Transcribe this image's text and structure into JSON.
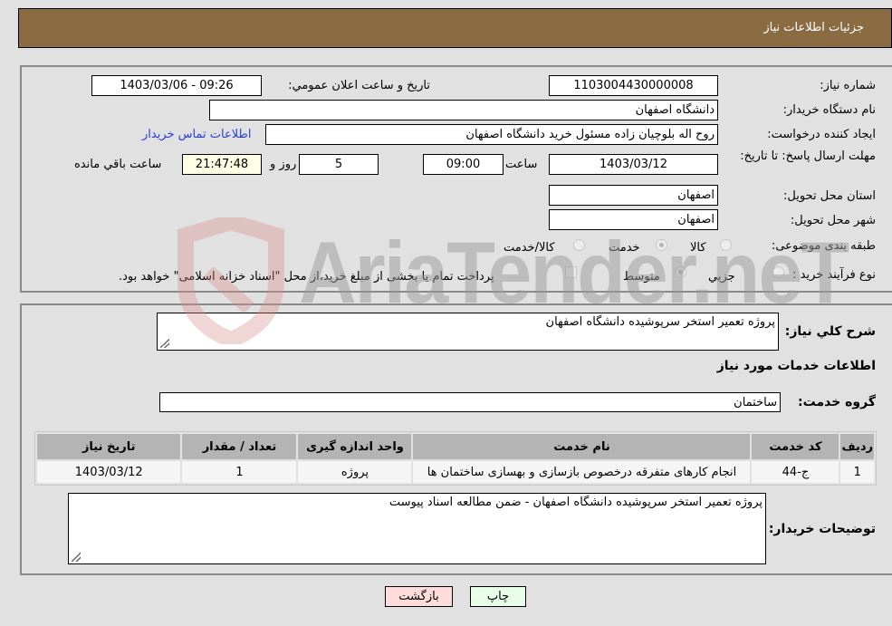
{
  "header": {
    "title": "جزئيات اطلاعات نياز"
  },
  "form": {
    "need_number_label": "شماره نياز:",
    "need_number": "1103004430000008",
    "announce_label": "تاريخ و ساعت اعلان عمومي:",
    "announce_value": "1403/03/06 - 09:26",
    "buyer_org_label": "نام دستگاه خريدار:",
    "buyer_org": "دانشگاه اصفهان",
    "creator_label": "ايجاد کننده درخواست:",
    "creator": "روح اله بلوچيان زاده مسئول خريد دانشگاه اصفهان",
    "contact_link": "اطلاعات تماس خريدار",
    "deadline_label": "مهلت ارسال پاسخ: تا تاريخ:",
    "deadline_date": "1403/03/12",
    "time_label": "ساعت",
    "deadline_time": "09:00",
    "days_value": "5",
    "days_label": "روز و",
    "remaining_time": "21:47:48",
    "remaining_label": "ساعت باقي مانده",
    "province_label": "استان محل تحويل:",
    "province": "اصفهان",
    "city_label": "شهر محل تحويل:",
    "city": "اصفهان",
    "category_label": "طبقه بندی موضوعی:",
    "category_options": [
      {
        "label": "کالا",
        "selected": false
      },
      {
        "label": "خدمت",
        "selected": true
      },
      {
        "label": "کالا/خدمت",
        "selected": false
      }
    ],
    "process_label": "نوع فرآيند خريد :",
    "process_options": [
      {
        "label": "جزيي",
        "selected": false
      },
      {
        "label": "متوسط",
        "selected": true
      }
    ],
    "treasury_note": "پرداخت تمام يا بخشی از مبلغ خريد،از محل \"اسناد خزانه اسلامی\" خواهد بود.",
    "treasury_checked": false
  },
  "details": {
    "summary_label": "شرح کلي نياز:",
    "summary": "پروژه تعمير استخر سرپوشيده دانشگاه اصفهان",
    "services_heading": "اطلاعات خدمات مورد نياز",
    "service_group_label": "گروه خدمت:",
    "service_group": "ساختمان",
    "table": {
      "headers": [
        "رديف",
        "کد خدمت",
        "نام خدمت",
        "واحد اندازه گيری",
        "تعداد / مقدار",
        "تاريخ نياز"
      ],
      "rows": [
        [
          "1",
          "ج-44",
          "انجام کارهای متفرقه درخصوص بازسازی و بهسازی ساختمان ها",
          "پروژه",
          "1",
          "1403/03/12"
        ]
      ]
    },
    "buyer_notes_label": "توضيحات خريدار:",
    "buyer_notes": "پروژه تعمير استخر سرپوشيده دانشگاه اصفهان - ضمن مطالعه اسناد پيوست"
  },
  "buttons": {
    "back": "بازگشت",
    "print": "چاپ"
  },
  "watermark": {
    "text": "AriaTender.neT"
  }
}
